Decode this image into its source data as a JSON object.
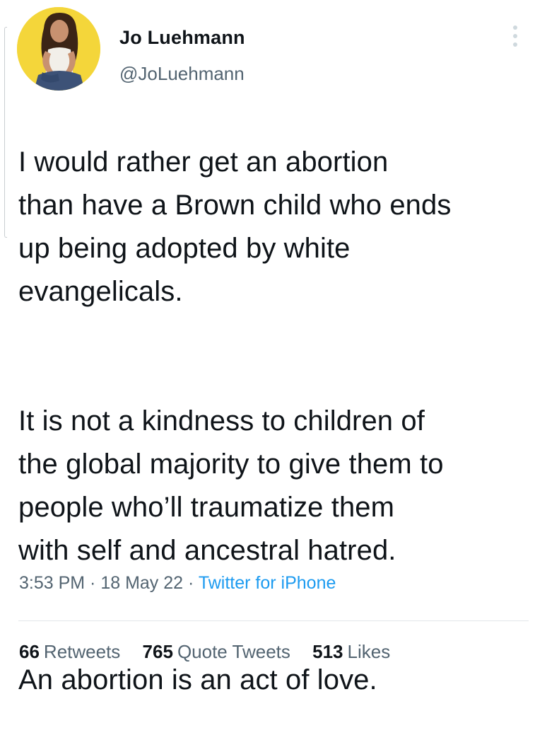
{
  "tweet": {
    "author": {
      "name": "Jo Luehmann",
      "handle": "@JoLuehmann"
    },
    "paragraphs": [
      "I would rather get an abortion\nthan have a Brown child who ends\nup being adopted by white\nevangelicals.",
      "It is not a kindness to children of\nthe global majority to give them to\npeople who’ll traumatize them\nwith self and ancestral hatred.",
      "An abortion is an act of love."
    ],
    "time": "3:53 PM",
    "separator": " · ",
    "date": "18 May 22",
    "source": "Twitter for iPhone",
    "stats": {
      "retweets_count": "66",
      "retweets_label": "Retweets",
      "quotes_count": "765",
      "quotes_label": "Quote Tweets",
      "likes_count": "513",
      "likes_label": "Likes"
    }
  },
  "colors": {
    "text": "#0f1419",
    "secondary": "#536471",
    "link": "#1d9bf0",
    "avatar_bg": "#f4d63a"
  },
  "icons": {
    "more": "more-vertical-icon"
  }
}
